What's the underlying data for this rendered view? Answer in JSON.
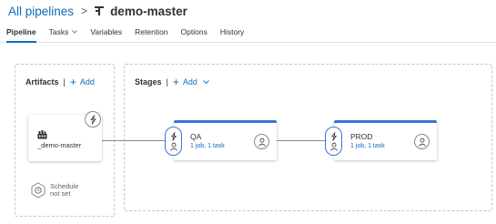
{
  "breadcrumb": {
    "parent": "All pipelines",
    "separator": ">",
    "current": "demo-master"
  },
  "tabs": [
    {
      "label": "Pipeline",
      "active": true
    },
    {
      "label": "Tasks",
      "active": false,
      "has_dropdown": true
    },
    {
      "label": "Variables",
      "active": false
    },
    {
      "label": "Retention",
      "active": false
    },
    {
      "label": "Options",
      "active": false
    },
    {
      "label": "History",
      "active": false
    }
  ],
  "artifacts": {
    "heading": "Artifacts",
    "divider": "|",
    "add_label": "Add",
    "card": {
      "name": "_demo-master",
      "icon": "build-artifact-icon"
    },
    "schedule": {
      "line1": "Schedule",
      "line2": "not set"
    }
  },
  "stages": {
    "heading": "Stages",
    "divider": "|",
    "add_label": "Add",
    "items": [
      {
        "name": "QA",
        "detail": "1 job, 1 task"
      },
      {
        "name": "PROD",
        "detail": "1 job, 1 task"
      }
    ]
  },
  "colors": {
    "accent": "#0f6cbd",
    "stage_bar": "#3a72d8",
    "border": "#c8c6c4"
  }
}
